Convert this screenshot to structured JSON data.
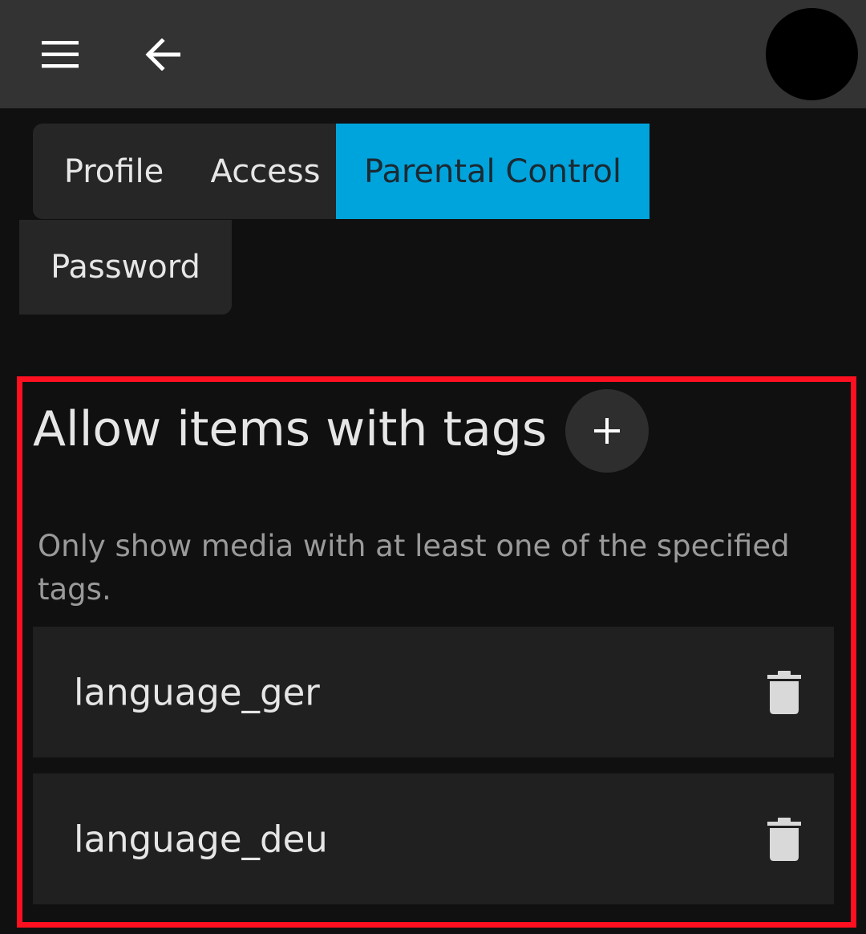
{
  "header": {
    "menu_icon": "hamburger-menu-icon",
    "back_icon": "arrow-left-icon",
    "avatar_color": "#000000"
  },
  "tabs": [
    {
      "label": "Profile",
      "active": false
    },
    {
      "label": "Access",
      "active": false
    },
    {
      "label": "Parental Control",
      "active": true
    },
    {
      "label": "Password",
      "active": false
    }
  ],
  "accent_color": "#00a4dc",
  "highlight_color": "#ff1020",
  "allowed_tags": {
    "title": "Allow items with tags",
    "add_icon": "plus-icon",
    "description": "Only show media with at least one of the specified tags.",
    "items": [
      {
        "tag": "language_ger",
        "delete_icon": "trash-icon"
      },
      {
        "tag": "language_deu",
        "delete_icon": "trash-icon"
      }
    ]
  }
}
